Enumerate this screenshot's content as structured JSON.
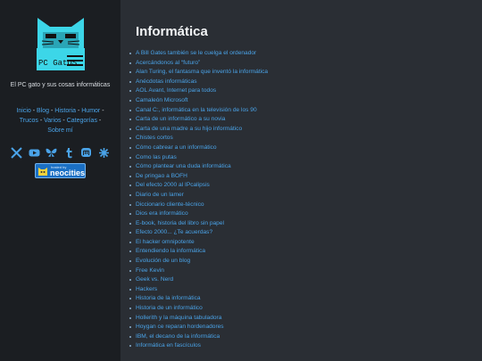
{
  "sidebar": {
    "logo_text": "PC GatOS",
    "tagline": "El PC gato y sus cosas informáticas",
    "nav": {
      "items": [
        "Inicio",
        "Blog",
        "Historia",
        "Humor",
        "Trucos",
        "Varios",
        "Categorías",
        "Sobre mí"
      ],
      "separator": " - "
    },
    "social_icons": [
      "x-icon",
      "youtube-icon",
      "bluesky-icon",
      "tumblr-icon",
      "mastodon-icon",
      "pinwheel-icon"
    ],
    "badge": {
      "small": "hosted by",
      "big": "neocities"
    }
  },
  "main": {
    "title": "Informática",
    "articles": [
      "A Bill Gates también se le cuelga el ordenador",
      "Acercándonos al “futuro”",
      "Alan Turing, el fantasma que inventó la informática",
      "Anécdotas informáticas",
      "AOL Avant, Internet para todos",
      "Camaleón Microsoft",
      "Canal C:, informática en la televisión de los 90",
      "Carta de un informático a su novia",
      "Carta de una madre a su hijo informático",
      "Chistes cortos",
      "Cómo cabrear a un informático",
      "Como las putas",
      "Cómo plantear una duda informática",
      "De pringao a BOFH",
      "Del efecto 2000 al IPcalipsis",
      "Diario de un lamer",
      "Diccionario cliente-técnico",
      "Dios era informático",
      "E-book, historia del libro sin papel",
      "Efecto 2000... ¿Te acuerdas?",
      "El hacker omnipotente",
      "Entendiendo la informática",
      "Evolución de un blog",
      "Free Kevin",
      "Geek vs. Nerd",
      "Hackers",
      "Historia de la informática",
      "Historia de un informático",
      "Hollerith y la máquina tabuladora",
      "Hoygan ce reparan hordenadores",
      "IBM, el decano de la informática",
      "Informática en fascículos"
    ]
  },
  "colors": {
    "accent": "#4aa3e8",
    "logo": "#3cd6e8",
    "sidebar_bg": "#1b1e22",
    "main_bg": "#2a2e34"
  }
}
